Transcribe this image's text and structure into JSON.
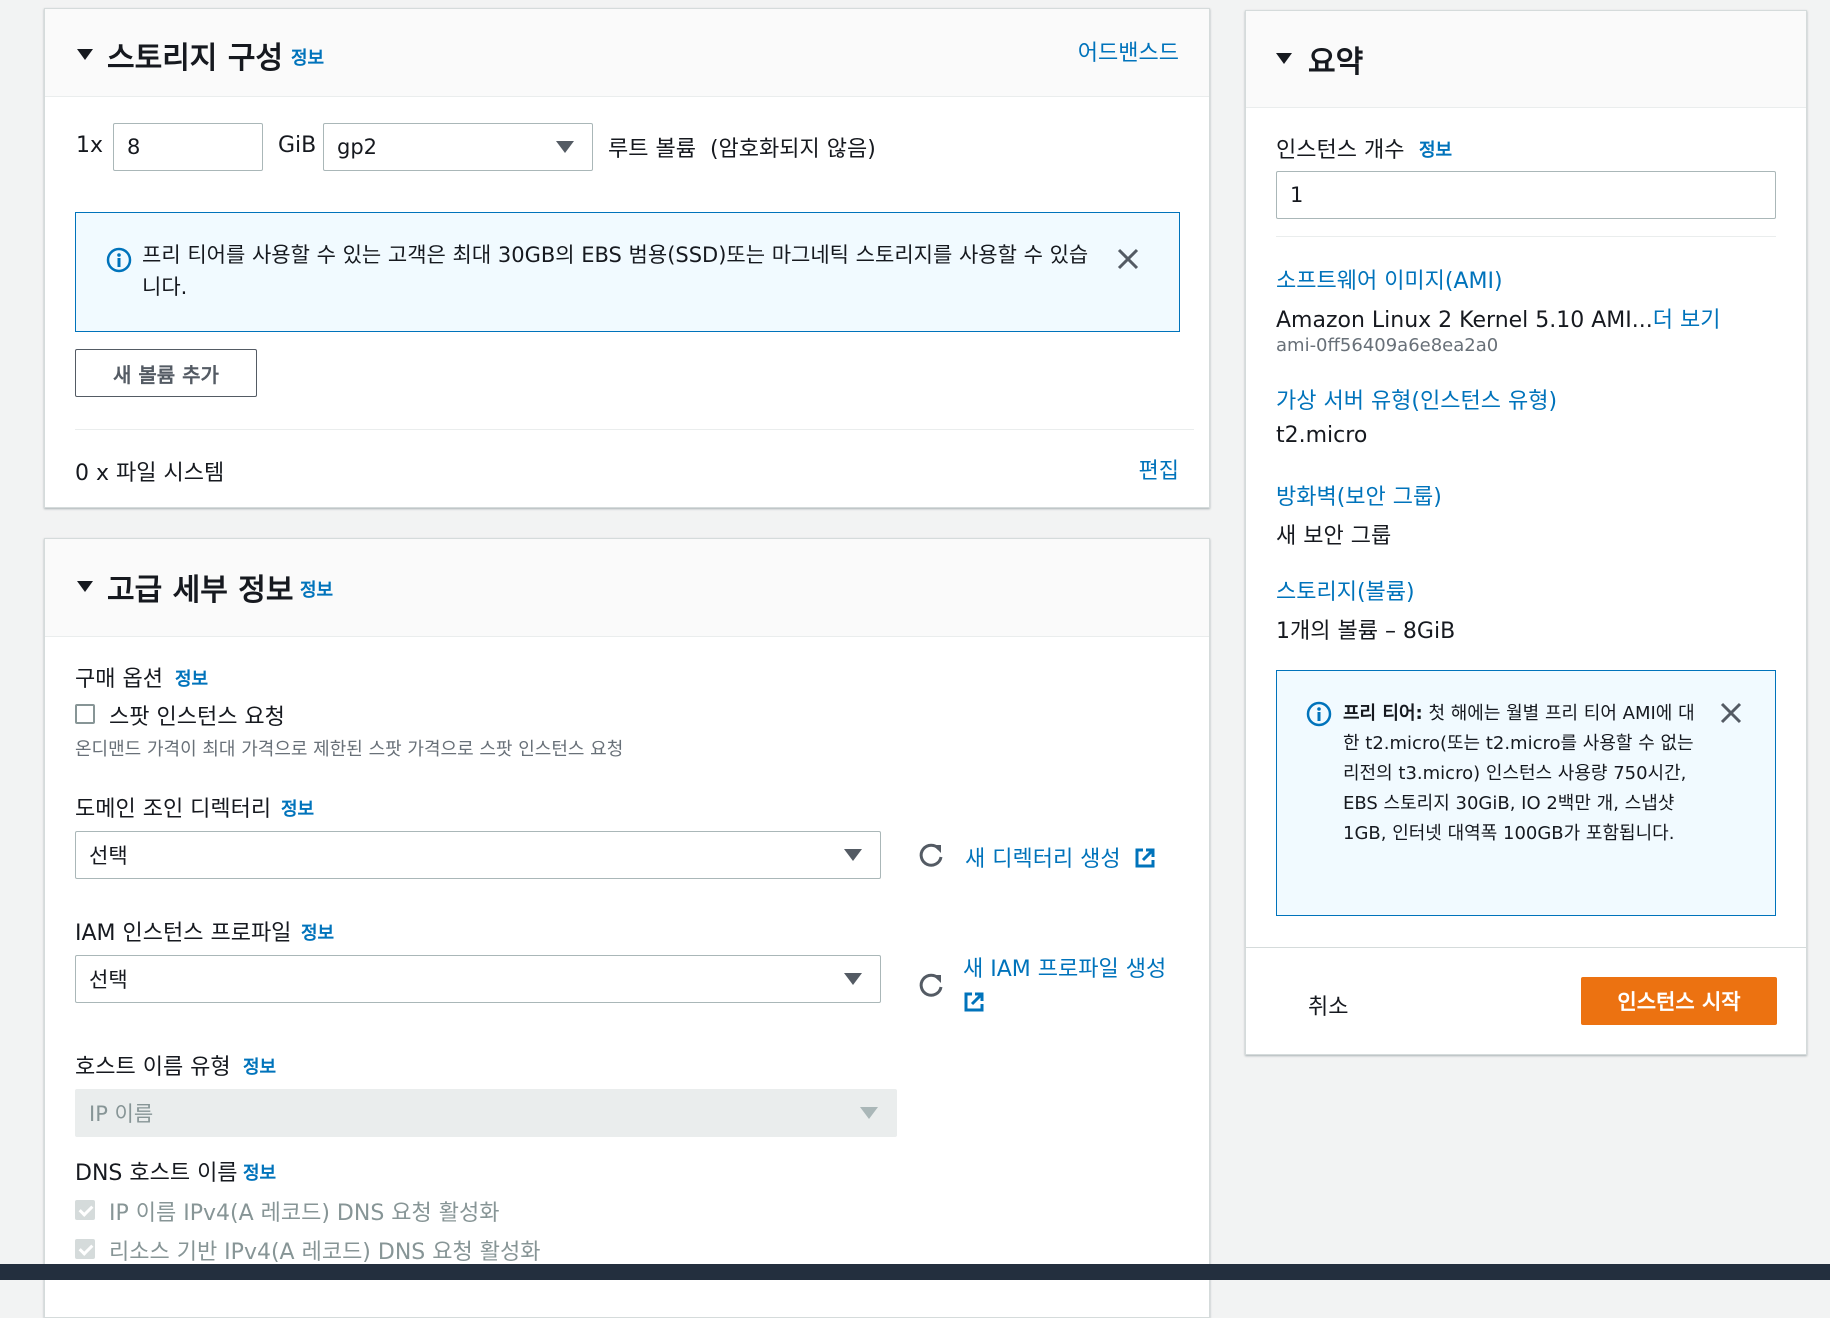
{
  "storage": {
    "title": "스토리지 구성",
    "info": "정보",
    "advanced": "어드밴스드",
    "count": "1x",
    "size_value": "8",
    "unit": "GiB",
    "volume_type": "gp2",
    "volume_desc": "루트 볼륨  (암호화되지 않음)",
    "alert_text": "프리 티어를 사용할 수 있는 고객은 최대 30GB의 EBS 범용(SSD)또는 마그네틱 스토리지를 사용할 수 있습니다.",
    "add_volume": "새 볼륨 추가",
    "filesystem": "0 x 파일 시스템",
    "edit": "편집"
  },
  "advanced": {
    "title": "고급 세부 정보",
    "info": "정보",
    "purchase_label": "구매 옵션",
    "spot_label": "스팟 인스턴스 요청",
    "spot_desc": "온디맨드 가격이 최대 가격으로 제한된 스팟 가격으로 스팟 인스턴스 요청",
    "domain_label": "도메인 조인 디렉터리",
    "domain_value": "선택",
    "new_directory": "새 디렉터리 생성",
    "iam_label": "IAM 인스턴스 프로파일",
    "iam_value": "선택",
    "new_iam_profile": "새 IAM 프로파일 생성",
    "hostname_label": "호스트 이름 유형",
    "hostname_value": "IP 이름",
    "dns_label": "DNS 호스트 이름",
    "dns_opt1": "IP 이름 IPv4(A 레코드) DNS 요청 활성화",
    "dns_opt2": "리소스 기반 IPv4(A 레코드) DNS 요청 활성화"
  },
  "summary": {
    "title": "요약",
    "count_label": "인스턴스 개수",
    "info": "정보",
    "count_value": "1",
    "ami_link": "소프트웨어 이미지(AMI)",
    "ami_name": "Amazon Linux 2 Kernel 5.10 AMI...",
    "ami_more": "더 보기",
    "ami_id": "ami-0ff56409a6e8ea2a0",
    "type_link": "가상 서버 유형(인스턴스 유형)",
    "type_value": "t2.micro",
    "firewall_link": "방화벽(보안 그룹)",
    "firewall_value": "새 보안 그룹",
    "storage_link": "스토리지(볼륨)",
    "storage_value": "1개의 볼륨 – 8GiB",
    "alert_bold": "프리 티어:",
    "alert_text": " 첫 해에는 월별 프리 티어 AMI에 대한 t2.micro(또는 t2.micro를 사용할 수 없는 리전의 t3.micro) 인스턴스 사용량 750시간, EBS 스토리지 30GiB, IO 2백만 개, 스냅샷 1GB, 인터넷 대역폭 100GB가 포함됩니다.",
    "cancel": "취소",
    "launch": "인스턴스 시작"
  },
  "colors": {
    "link": "#0073bb",
    "primary": "#ec7211",
    "alert_bg": "#f1faff"
  }
}
